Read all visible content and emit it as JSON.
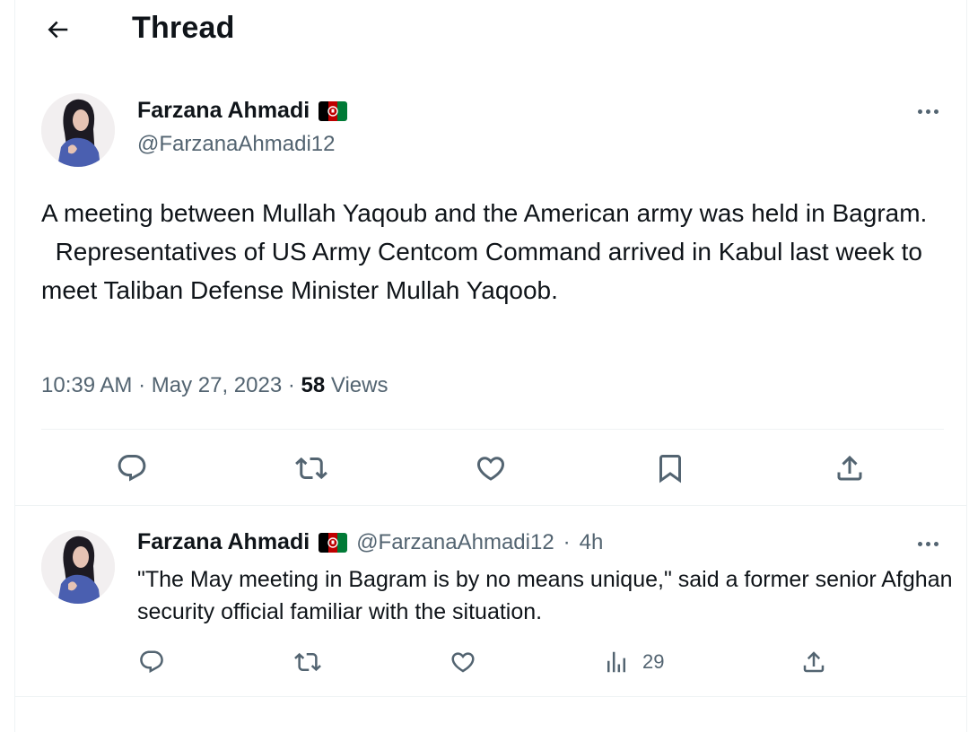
{
  "header": {
    "title": "Thread",
    "back_icon": "arrow-left-icon"
  },
  "main_tweet": {
    "author_name": "Farzana Ahmadi",
    "author_flag": "afghanistan-flag-icon",
    "handle": "@FarzanaAhmadi12",
    "text_lines": [
      "A meeting between Mullah Yaqoub and the American army was held in Bagram.",
      "  Representatives of US Army Centcom Command arrived in Kabul last week to meet Taliban Defense Minister Mullah Yaqoob."
    ],
    "time": "10:39 AM",
    "separator": " · ",
    "date": "May 27, 2023",
    "views_count": "58",
    "views_label": " Views",
    "actions": [
      "reply-icon",
      "retweet-icon",
      "like-icon",
      "bookmark-icon",
      "share-icon"
    ]
  },
  "reply_tweet": {
    "author_name": "Farzana Ahmadi",
    "author_flag": "afghanistan-flag-icon",
    "handle": "@FarzanaAhmadi12",
    "dot": "·",
    "time": "4h",
    "text": "\"The May meeting in Bagram is by no means unique,\" said a former senior Afghan security official familiar with the situation.",
    "views_count": "29",
    "actions": [
      "reply-icon",
      "retweet-icon",
      "like-icon",
      "views-icon",
      "share-icon"
    ]
  },
  "colors": {
    "text_primary": "#0f1419",
    "text_secondary": "#536471",
    "divider": "#eff3f4",
    "flag_black": "#000000",
    "flag_red": "#be0000",
    "flag_green": "#007a36"
  }
}
